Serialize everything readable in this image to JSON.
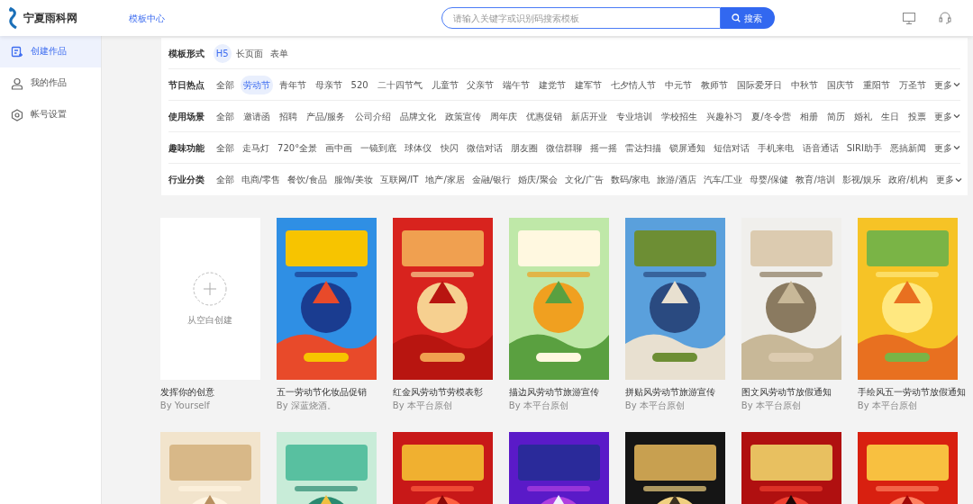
{
  "header": {
    "logo_text": "宁夏雨科网",
    "nav_link": "模板中心",
    "search": {
      "placeholder": "请输入关键字或识别码搜索模板",
      "button": "搜索"
    }
  },
  "sidebar": {
    "items": [
      {
        "label": "创建作品",
        "selected": true,
        "kind": "create"
      },
      {
        "label": "我的作品",
        "selected": false,
        "kind": "user"
      },
      {
        "label": "帐号设置",
        "selected": false,
        "kind": "settings"
      }
    ]
  },
  "filters": [
    {
      "label": "模板形式",
      "options": [
        {
          "label": "H5",
          "selected": true
        },
        {
          "label": "长页面",
          "selected": false
        },
        {
          "label": "表单",
          "selected": false
        }
      ]
    },
    {
      "label": "节日热点",
      "more": "更多",
      "options": [
        {
          "label": "全部",
          "selected": false
        },
        {
          "label": "劳动节",
          "selected": true
        },
        {
          "label": "青年节",
          "selected": false
        },
        {
          "label": "母亲节",
          "selected": false
        },
        {
          "label": "520",
          "selected": false
        },
        {
          "label": "二十四节气",
          "selected": false
        },
        {
          "label": "儿童节",
          "selected": false
        },
        {
          "label": "父亲节",
          "selected": false
        },
        {
          "label": "端午节",
          "selected": false
        },
        {
          "label": "建党节",
          "selected": false
        },
        {
          "label": "建军节",
          "selected": false
        },
        {
          "label": "七夕情人节",
          "selected": false
        },
        {
          "label": "中元节",
          "selected": false
        },
        {
          "label": "教师节",
          "selected": false
        },
        {
          "label": "国际爱牙日",
          "selected": false
        },
        {
          "label": "中秋节",
          "selected": false
        },
        {
          "label": "国庆节",
          "selected": false
        },
        {
          "label": "重阳节",
          "selected": false
        },
        {
          "label": "万圣节",
          "selected": false
        }
      ]
    },
    {
      "label": "使用场景",
      "more": "更多",
      "options": [
        {
          "label": "全部",
          "selected": false
        },
        {
          "label": "邀请函",
          "selected": false
        },
        {
          "label": "招聘",
          "selected": false
        },
        {
          "label": "产品/服务",
          "selected": false
        },
        {
          "label": "公司介绍",
          "selected": false
        },
        {
          "label": "品牌文化",
          "selected": false
        },
        {
          "label": "政策宣传",
          "selected": false
        },
        {
          "label": "周年庆",
          "selected": false
        },
        {
          "label": "优惠促销",
          "selected": false
        },
        {
          "label": "新店开业",
          "selected": false
        },
        {
          "label": "专业培训",
          "selected": false
        },
        {
          "label": "学校招生",
          "selected": false
        },
        {
          "label": "兴趣补习",
          "selected": false
        },
        {
          "label": "夏/冬令营",
          "selected": false
        },
        {
          "label": "相册",
          "selected": false
        },
        {
          "label": "简历",
          "selected": false
        },
        {
          "label": "婚礼",
          "selected": false
        },
        {
          "label": "生日",
          "selected": false
        },
        {
          "label": "投票",
          "selected": false
        }
      ]
    },
    {
      "label": "趣味功能",
      "more": "更多",
      "options": [
        {
          "label": "全部",
          "selected": false
        },
        {
          "label": "走马灯",
          "selected": false
        },
        {
          "label": "720°全景",
          "selected": false
        },
        {
          "label": "画中画",
          "selected": false
        },
        {
          "label": "一镜到底",
          "selected": false
        },
        {
          "label": "球体仪",
          "selected": false
        },
        {
          "label": "快闪",
          "selected": false
        },
        {
          "label": "微信对话",
          "selected": false
        },
        {
          "label": "朋友圈",
          "selected": false
        },
        {
          "label": "微信群聊",
          "selected": false
        },
        {
          "label": "摇一摇",
          "selected": false
        },
        {
          "label": "雷达扫描",
          "selected": false
        },
        {
          "label": "锁屏通知",
          "selected": false
        },
        {
          "label": "短信对话",
          "selected": false
        },
        {
          "label": "手机来电",
          "selected": false
        },
        {
          "label": "语音通话",
          "selected": false
        },
        {
          "label": "SIRI助手",
          "selected": false
        },
        {
          "label": "恶搞新闻",
          "selected": false
        }
      ]
    },
    {
      "label": "行业分类",
      "more": "更多",
      "options": [
        {
          "label": "全部",
          "selected": false
        },
        {
          "label": "电商/零售",
          "selected": false
        },
        {
          "label": "餐饮/食品",
          "selected": false
        },
        {
          "label": "服饰/美妆",
          "selected": false
        },
        {
          "label": "互联网/IT",
          "selected": false
        },
        {
          "label": "地产/家居",
          "selected": false
        },
        {
          "label": "金融/银行",
          "selected": false
        },
        {
          "label": "婚庆/聚会",
          "selected": false
        },
        {
          "label": "文化/广告",
          "selected": false
        },
        {
          "label": "数码/家电",
          "selected": false
        },
        {
          "label": "旅游/酒店",
          "selected": false
        },
        {
          "label": "汽车/工业",
          "selected": false
        },
        {
          "label": "母婴/保健",
          "selected": false
        },
        {
          "label": "教育/培训",
          "selected": false
        },
        {
          "label": "影视/娱乐",
          "selected": false
        },
        {
          "label": "政府/机构",
          "selected": false
        }
      ]
    }
  ],
  "templates": [
    {
      "kind": "blank",
      "label": "从空白创建",
      "title": "发挥你的创意",
      "author": "By Yourself"
    },
    {
      "kind": "picture",
      "title": "五一劳动节化妆品促销",
      "author": "By 深蓝烧酒。"
    },
    {
      "kind": "picture",
      "title": "红金风劳动节劳模表彰",
      "author": "By 本平台原创"
    },
    {
      "kind": "picture",
      "title": "描边风劳动节旅游宣传",
      "author": "By 本平台原创"
    },
    {
      "kind": "picture",
      "title": "拼贴风劳动节旅游宣传",
      "author": "By 本平台原创"
    },
    {
      "kind": "picture",
      "title": "图文风劳动节放假通知",
      "author": "By 本平台原创"
    },
    {
      "kind": "picture",
      "title": "手绘风五一劳动节放假通知",
      "author": "By 本平台原创"
    },
    {
      "kind": "picture"
    },
    {
      "kind": "picture"
    },
    {
      "kind": "picture"
    },
    {
      "kind": "picture"
    },
    {
      "kind": "picture"
    },
    {
      "kind": "picture"
    },
    {
      "kind": "picture"
    }
  ]
}
